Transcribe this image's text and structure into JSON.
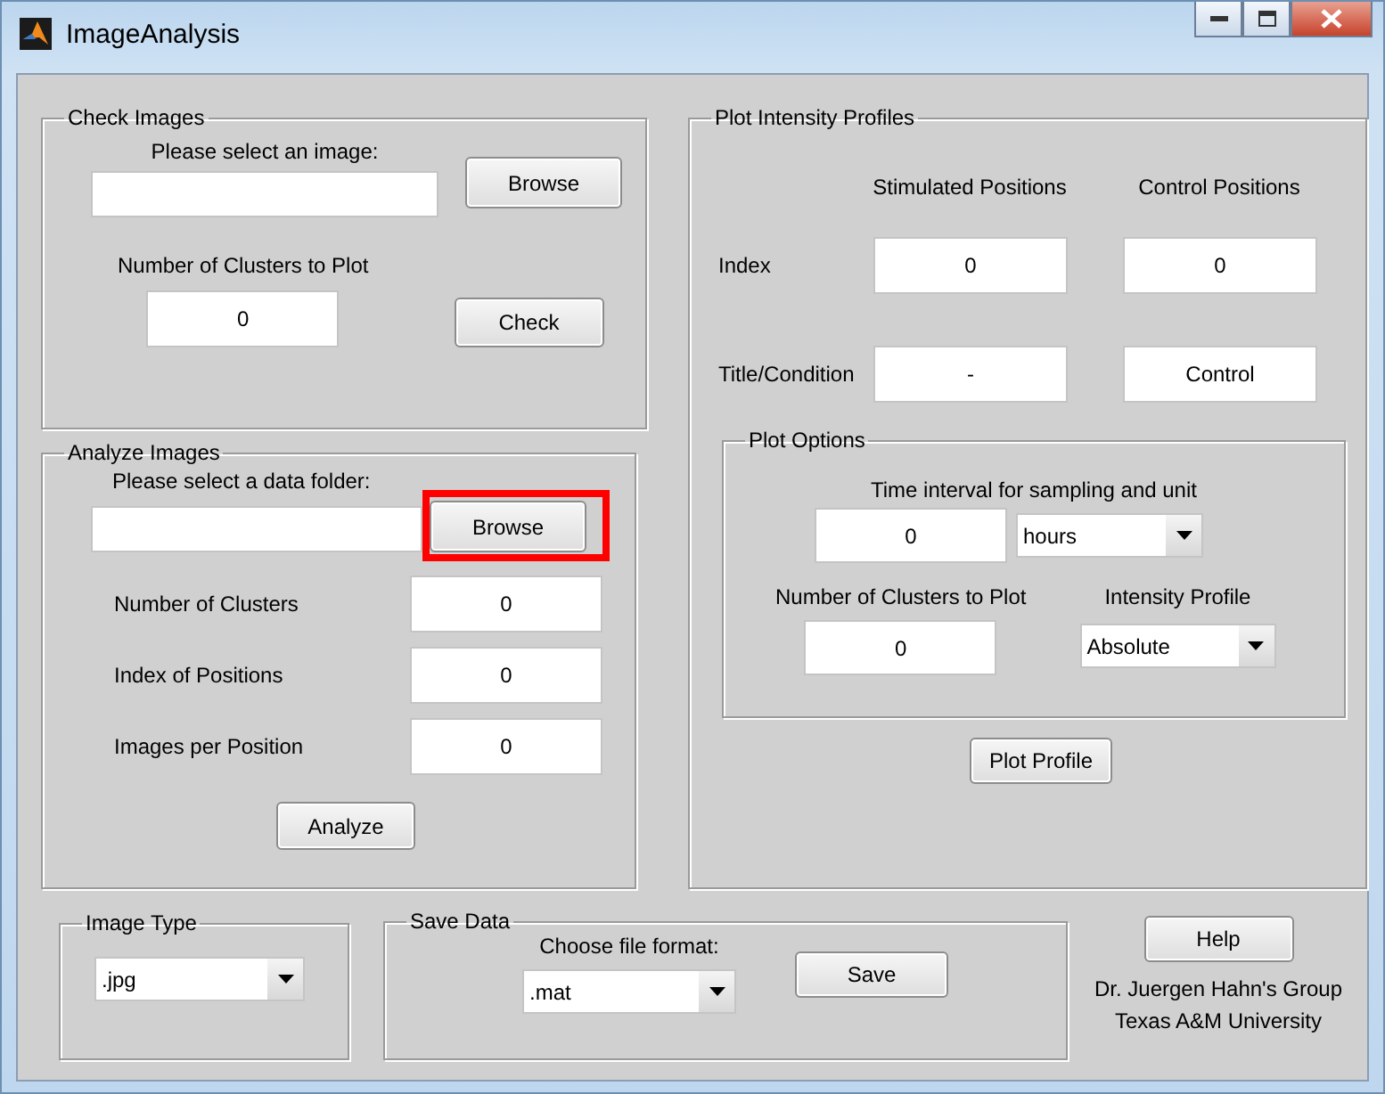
{
  "window": {
    "title": "ImageAnalysis"
  },
  "check_images": {
    "title": "Check Images",
    "image_prompt": "Please select an image:",
    "browse_button": {
      "label": "Browse",
      "highlighted": false
    },
    "clusters_label": "Number of Clusters to Plot",
    "clusters_value": "0",
    "check_button": "Check"
  },
  "analyze_images": {
    "title": "Analyze Images",
    "folder_prompt": "Please select a data folder:",
    "browse_button": {
      "label": "Browse",
      "highlighted": true
    },
    "fields": [
      {
        "label": "Number of Clusters",
        "value": "0"
      },
      {
        "label": "Index of Positions",
        "value": "0"
      },
      {
        "label": "Images per Position",
        "value": "0"
      }
    ],
    "analyze_button": "Analyze"
  },
  "plot_intensity_profiles": {
    "title": "Plot Intensity Profiles",
    "columns": [
      "Stimulated Positions",
      "Control Positions"
    ],
    "rows": [
      {
        "label": "Index",
        "values": [
          "0",
          "0"
        ]
      },
      {
        "label": "Title/Condition",
        "values": [
          "-",
          "Control"
        ]
      }
    ],
    "plot_options": {
      "title": "Plot Options",
      "time_label": "Time interval for sampling and unit",
      "time_value": "0",
      "time_unit": "hours",
      "clusters_label": "Number of Clusters to Plot",
      "clusters_value": "0",
      "profile_label": "Intensity Profile",
      "profile_value": "Absolute"
    },
    "plot_button": "Plot Profile"
  },
  "image_type": {
    "title": "Image Type",
    "value": ".jpg"
  },
  "save_data": {
    "title": "Save Data",
    "format_label": "Choose file format:",
    "format_value": ".mat",
    "save_button": "Save"
  },
  "help_button": "Help",
  "credits": [
    "Dr. Juergen Hahn's Group",
    "Texas A&M University"
  ]
}
